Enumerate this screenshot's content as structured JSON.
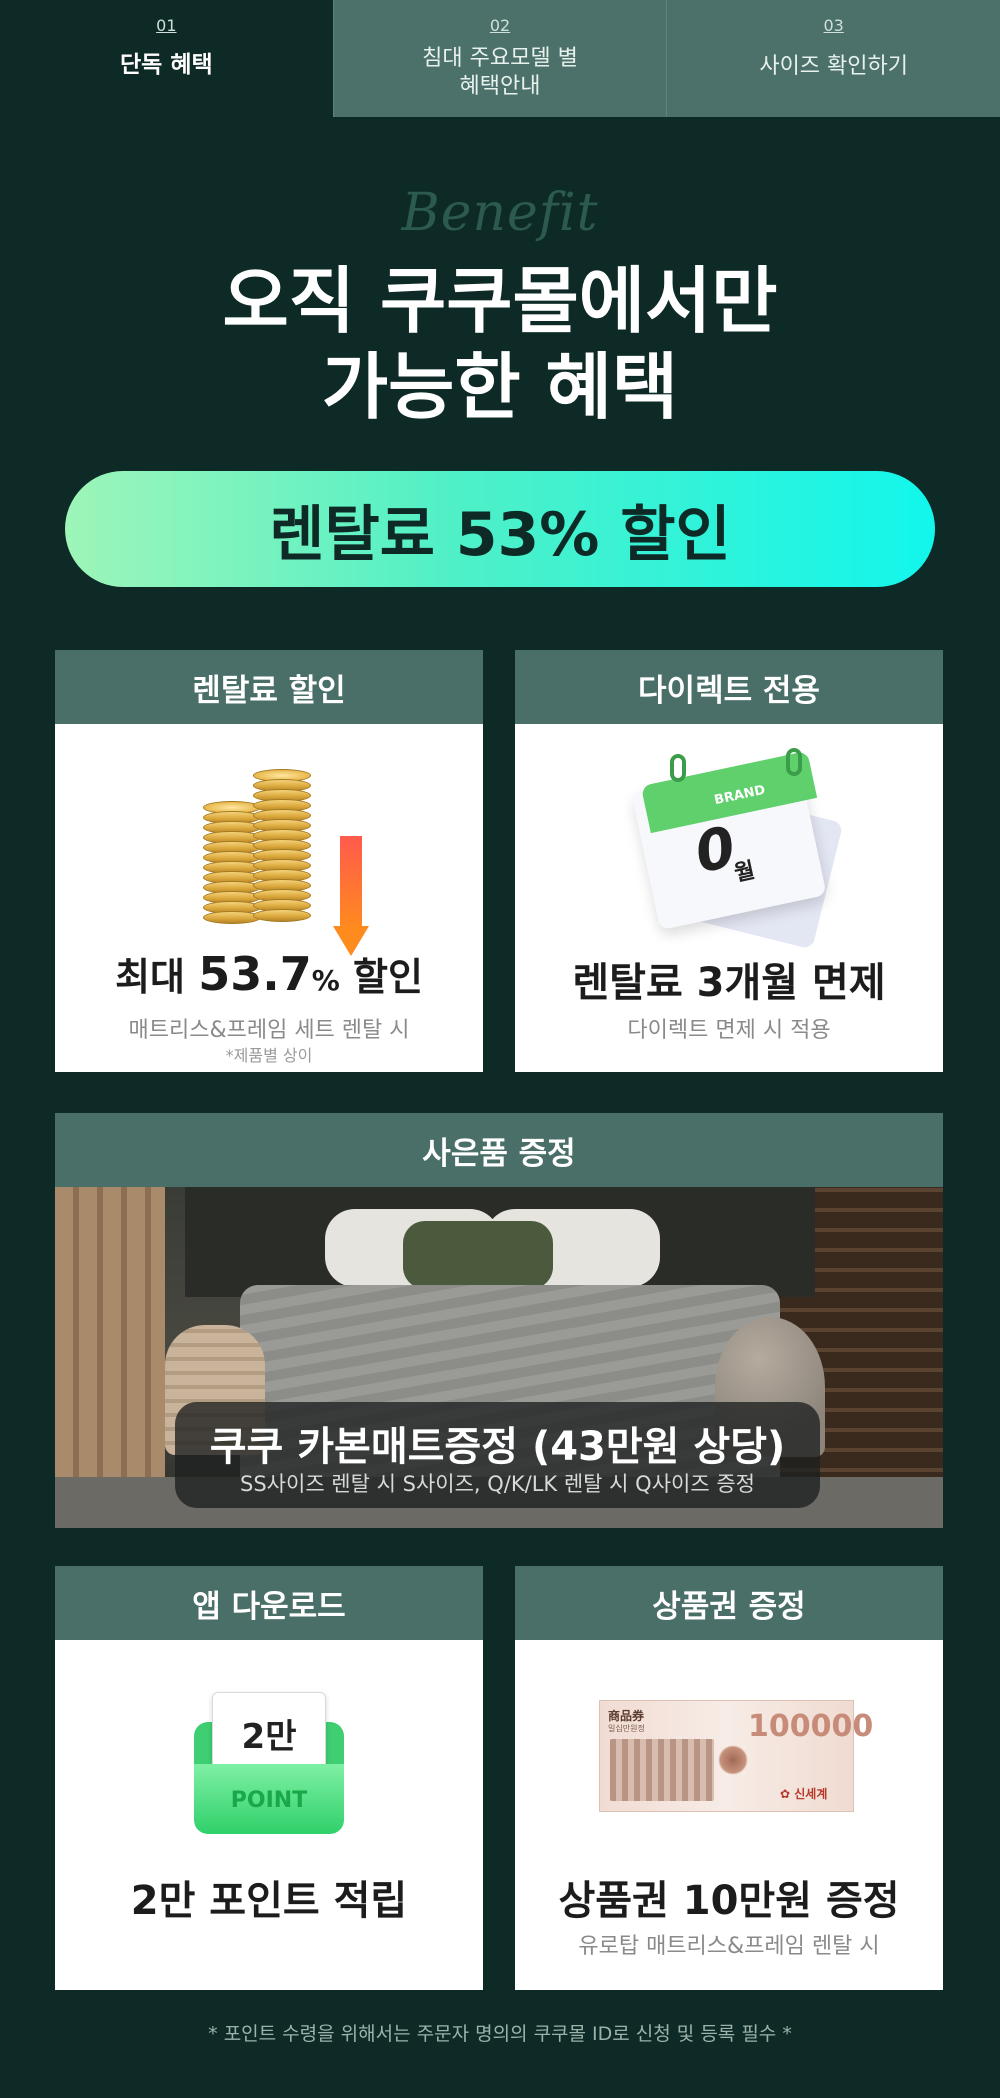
{
  "tabs": [
    {
      "num": "01",
      "label": "단독 혜택",
      "active": true
    },
    {
      "num": "02",
      "label": "침대 주요모델 별\n혜택안내",
      "active": false
    },
    {
      "num": "03",
      "label": "사이즈 확인하기",
      "active": false
    }
  ],
  "hero": {
    "script_word": "Benefit",
    "headline_line1": "오직 쿠쿠몰에서만",
    "headline_line2": "가능한 혜택",
    "pill": "렌탈료 53% 할인"
  },
  "cards": {
    "rental_discount": {
      "header": "렌탈료 할인",
      "title_prefix": "최대",
      "title_value": "53.7",
      "title_unit": "%",
      "title_suffix": "할인",
      "sub": "매트리스&프레임 세트 렌탈 시",
      "note": "*제품별 상이"
    },
    "direct_only": {
      "header": "다이렉트 전용",
      "calendar_brand": "BRAND",
      "calendar_zero": "0",
      "calendar_month": "월",
      "title": "렌탈료 3개월 면제",
      "sub": "다이렉트 면제 시 적용"
    },
    "gift": {
      "header": "사은품 증정",
      "title": "쿠쿠 카본매트증정 (43만원 상당)",
      "sub": "SS사이즈 렌탈 시 S사이즈, Q/K/LK 렌탈 시 Q사이즈 증정"
    },
    "app_download": {
      "header": "앱 다운로드",
      "envelope_amount": "2만",
      "envelope_label": "POINT",
      "title": "2만 포인트 적립"
    },
    "voucher": {
      "header": "상품권 증정",
      "voucher_label": "商品券",
      "voucher_sublabel": "일십만원정",
      "voucher_amount": "100000",
      "voucher_brand": "✿ 신세계",
      "title": "상품권 10만원 증정",
      "sub": "유로탑 매트리스&프레임 렌탈 시"
    }
  },
  "footer_note": "* 포인트 수령을 위해서는 주문자 명의의 쿠쿠몰 ID로 신청 및 등록 필수 *"
}
